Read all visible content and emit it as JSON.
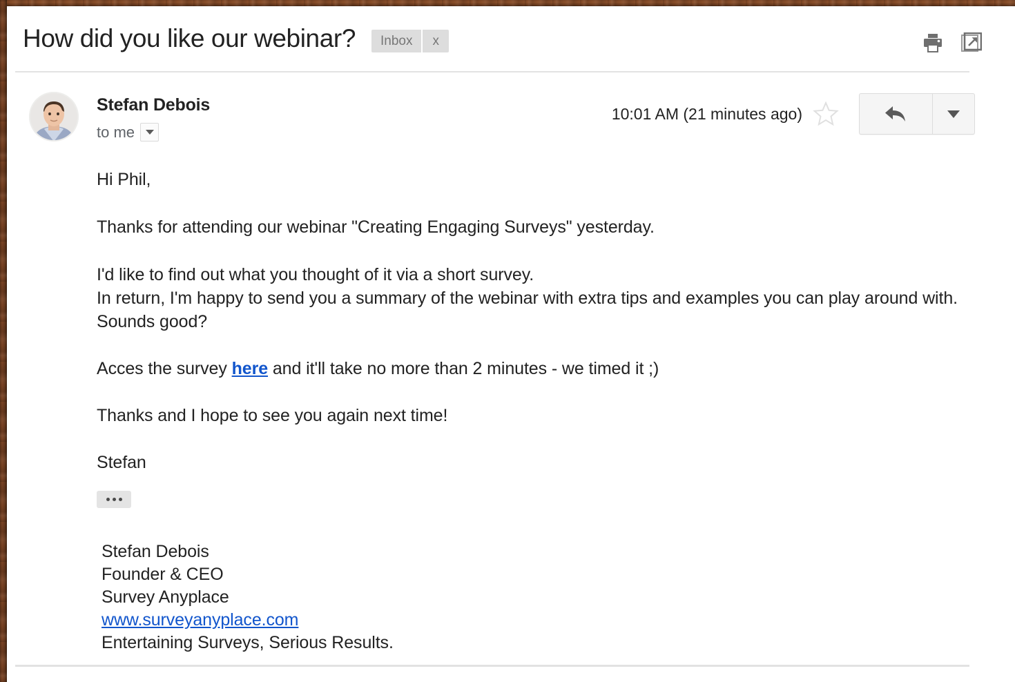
{
  "window": {
    "frame_color": "#7a4424",
    "surface_color": "#ffffff"
  },
  "header": {
    "subject": "How did you like our webinar?",
    "label": {
      "name": "Inbox",
      "remove": "x"
    },
    "actions": [
      {
        "name": "print-icon",
        "title": "Print all"
      },
      {
        "name": "open-in-new-window-icon",
        "title": "Open in new window"
      }
    ]
  },
  "message": {
    "sender_name": "Stefan Debois",
    "recipient_line": "to me",
    "recipient_caret": "▼",
    "timestamp": "10:01 AM (21 minutes ago)",
    "starred": false,
    "star_icon": "star-outline-icon",
    "reply_icon": "reply-arrow-icon",
    "more_icon": "chevron-down-icon"
  },
  "body": {
    "greeting": "Hi Phil,",
    "paragraph_1": "Thanks for attending our webinar \"Creating Engaging Surveys\" yesterday.",
    "paragraph_2_line_1": "I'd like to find out what you thought of it via a short survey.",
    "paragraph_2_line_2": "In return, I'm happy to send you a summary of the webinar with extra tips and examples you can play around with. Sounds good?",
    "paragraph_3_before_link": "Acces the survey ",
    "paragraph_3_link": "here",
    "paragraph_3_after_link": " and it'll take no more than 2 minutes - we timed it ;)",
    "paragraph_4": "Thanks and I hope to see you again next time!",
    "signoff": "Stefan",
    "expand_label": "•••"
  },
  "signature": {
    "name": "Stefan Debois",
    "title": "Founder & CEO",
    "company": "Survey Anyplace",
    "website": "www.surveyanyplace.com",
    "tagline": "Entertaining Surveys, Serious Results."
  },
  "colors": {
    "link": "#1155cc",
    "text": "#222222",
    "muted": "#777777",
    "chip_bg": "#dddddd",
    "button_bg": "#f5f5f5",
    "rule": "#e2e2e2"
  }
}
